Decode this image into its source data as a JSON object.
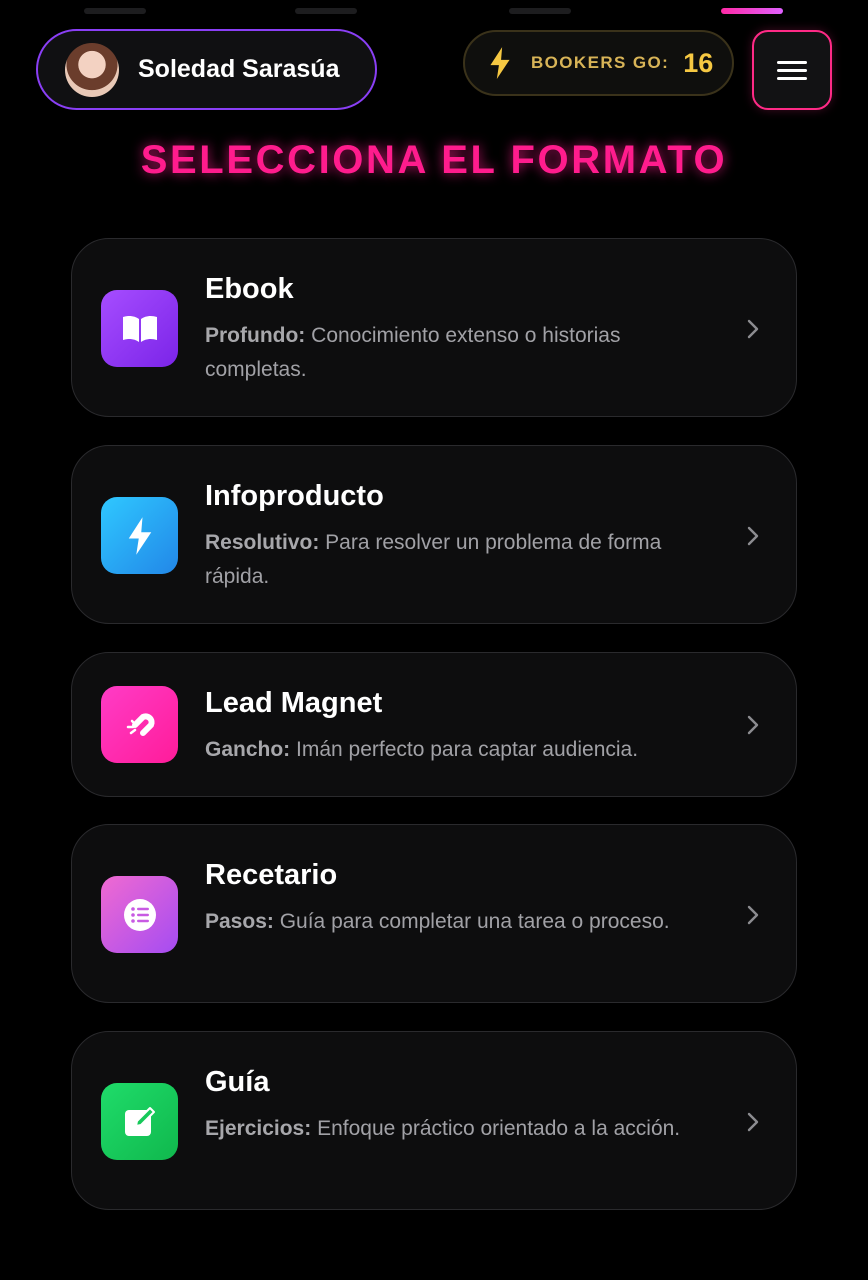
{
  "steps": [
    {
      "label": "",
      "active": false
    },
    {
      "label": "",
      "active": false
    },
    {
      "label": "",
      "active": false
    },
    {
      "label": "",
      "active": true
    }
  ],
  "header": {
    "user_name": "Soledad Sarasúa",
    "go_label": "BOOKERS GO:",
    "go_count": "16",
    "menu_icon": "hamburger-menu-icon"
  },
  "title": "SELECCIONA EL FORMATO",
  "formats": [
    {
      "title": "Ebook",
      "lead": "Profundo:",
      "text": " Conocimiento extenso o historias completas.",
      "icon": "book-icon",
      "color": "#9b3cf7"
    },
    {
      "title": "Infoproducto",
      "lead": "Resolutivo:",
      "text": " Para resolver un problema de forma rápida.",
      "icon": "lightning-icon",
      "color": "#26a8f2"
    },
    {
      "title": "Lead Magnet",
      "lead": "Gancho:",
      "text": " Imán perfecto para captar audiencia.",
      "icon": "magnet-icon",
      "color": "#ff22b0"
    },
    {
      "title": "Recetario",
      "lead": "Pasos:",
      "text": " Guía para completar una tarea o proceso.",
      "icon": "list-icon",
      "color": "#c85ae3"
    },
    {
      "title": "Guía",
      "lead": "Ejercicios:",
      "text": " Enfoque práctico orientado a la acción.",
      "icon": "edit-icon",
      "color": "#16c95a"
    }
  ],
  "colors": {
    "accent_pink": "#ff1c8d",
    "accent_purple": "#8a3ff5",
    "gold": "#f6c842",
    "card_bg": "#0d0d0e",
    "text_muted": "#a1a1a6"
  }
}
